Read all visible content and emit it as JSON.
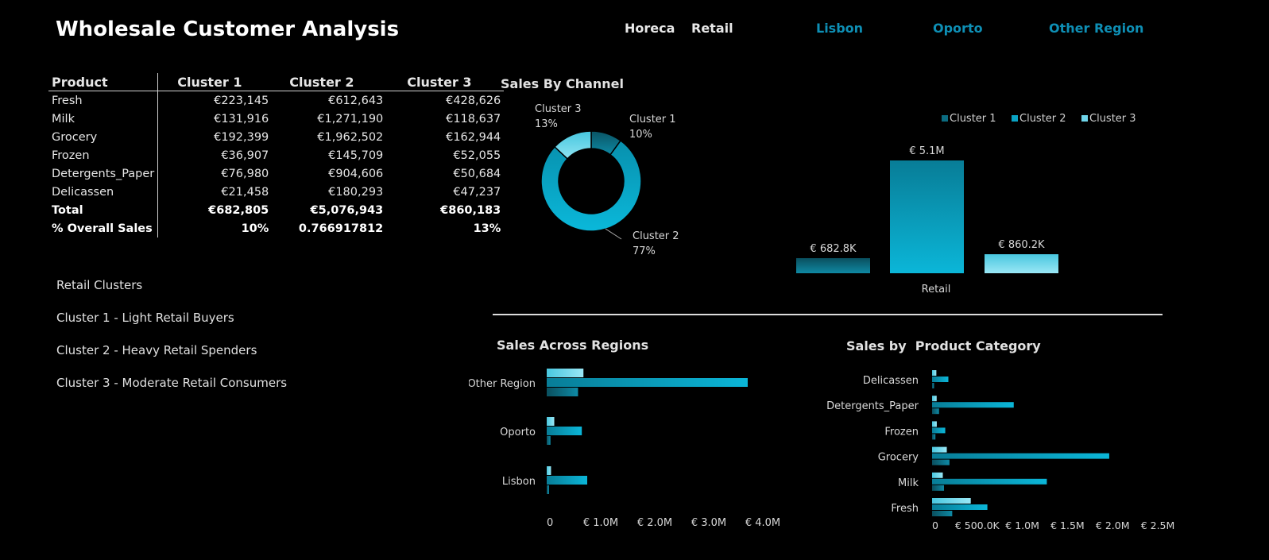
{
  "title": "Wholesale Customer Analysis",
  "slicers": [
    {
      "label": "Horeca",
      "selected": true
    },
    {
      "label": "Retail",
      "selected": true
    },
    {
      "label": "Lisbon",
      "selected": false
    },
    {
      "label": "Oporto",
      "selected": false
    },
    {
      "label": "Other Region",
      "selected": false
    }
  ],
  "table": {
    "headers": [
      "Product",
      "Cluster 1",
      "Cluster 2",
      "Cluster 3"
    ],
    "rows": [
      [
        "Fresh",
        "€223,145",
        "€612,643",
        "€428,626"
      ],
      [
        "Milk",
        "€131,916",
        "€1,271,190",
        "€118,637"
      ],
      [
        "Grocery",
        "€192,399",
        "€1,962,502",
        "€162,944"
      ],
      [
        "Frozen",
        "€36,907",
        "€145,709",
        "€52,055"
      ],
      [
        "Detergents_Paper",
        "€76,980",
        "€904,606",
        "€50,684"
      ],
      [
        "Delicassen",
        "€21,458",
        "€180,293",
        "€47,237"
      ]
    ],
    "total": [
      "Total",
      "€682,805",
      "€5,076,943",
      "€860,183"
    ],
    "overall": [
      "% Overall Sales",
      "10%",
      "0.766917812",
      "13%"
    ]
  },
  "notes": [
    "Retail Clusters",
    "Cluster 1 - Light Retail Buyers",
    "Cluster 2 - Heavy Retail Spenders",
    "Cluster 3 - Moderate Retail Consumers"
  ],
  "colors": {
    "cluster1": "#0b6b80",
    "cluster2": "#0aa3c4",
    "cluster3": "#6fd5ea"
  },
  "chart_data": [
    {
      "type": "pie",
      "variant": "donut",
      "title": "Sales By Channel",
      "labels": [
        "Cluster 1",
        "Cluster 2",
        "Cluster 3"
      ],
      "values": [
        10,
        77,
        13
      ],
      "value_labels": [
        "10%",
        "77%",
        "13%"
      ]
    },
    {
      "type": "bar",
      "title": "",
      "categories": [
        "Retail"
      ],
      "series": [
        {
          "name": "Cluster 1",
          "values": [
            0.6828
          ]
        },
        {
          "name": "Cluster 2",
          "values": [
            5.1
          ]
        },
        {
          "name": "Cluster 3",
          "values": [
            0.8602
          ]
        }
      ],
      "data_labels": [
        "€ 682.8K",
        "€ 5.1M",
        "€ 860.2K"
      ],
      "legend": "top-right",
      "ylim": [
        0,
        5.1
      ]
    },
    {
      "type": "bar",
      "orientation": "horizontal",
      "title": "Sales Across Regions",
      "categories": [
        "Other Region",
        "Oporto",
        "Lisbon"
      ],
      "series": [
        {
          "name": "Cluster 3",
          "values": [
            0.68,
            0.14,
            0.08
          ]
        },
        {
          "name": "Cluster 2",
          "values": [
            3.72,
            0.65,
            0.75
          ]
        },
        {
          "name": "Cluster 1",
          "values": [
            0.58,
            0.07,
            0.04
          ]
        }
      ],
      "xlim": [
        0,
        4.0
      ],
      "x_ticks": [
        "0",
        "€ 1.0M",
        "€ 2.0M",
        "€ 3.0M",
        "€ 4.0M"
      ]
    },
    {
      "type": "bar",
      "orientation": "horizontal",
      "title": "Sales by  Product Category",
      "categories": [
        "Delicassen",
        "Detergents_Paper",
        "Frozen",
        "Grocery",
        "Milk",
        "Fresh"
      ],
      "series": [
        {
          "name": "Cluster 3",
          "values": [
            47237,
            50684,
            52055,
            162944,
            118637,
            428626
          ]
        },
        {
          "name": "Cluster 2",
          "values": [
            180293,
            904606,
            145709,
            1962502,
            1271190,
            612643
          ]
        },
        {
          "name": "Cluster 1",
          "values": [
            21458,
            76980,
            36907,
            192399,
            131916,
            223145
          ]
        }
      ],
      "xlim": [
        0,
        2500000
      ],
      "x_ticks": [
        "0",
        "€ 500.0K",
        "€ 1.0M",
        "€ 1.5M",
        "€ 2.0M",
        "€ 2.5M"
      ]
    }
  ]
}
